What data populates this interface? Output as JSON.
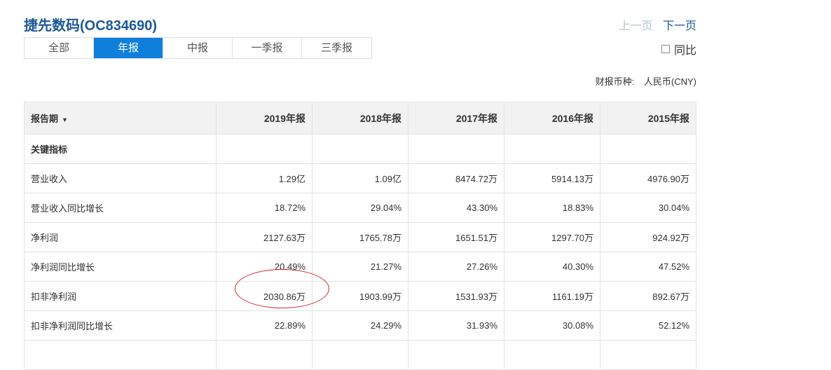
{
  "header": {
    "title": "捷先数码(OC834690)"
  },
  "tabs": [
    {
      "label": "全部"
    },
    {
      "label": "年报"
    },
    {
      "label": "中报"
    },
    {
      "label": "一季报"
    },
    {
      "label": "三季报"
    }
  ],
  "active_tab": "年报",
  "pager": {
    "prev": "上一页",
    "next": "下一页"
  },
  "yoy": {
    "label": "同比",
    "checked": false
  },
  "currency": {
    "label": "财报币种:",
    "value": "人民币(CNY)"
  },
  "table": {
    "header_label": "报告期",
    "sort_icon": "▼",
    "columns": [
      "2019年报",
      "2018年报",
      "2017年报",
      "2016年报",
      "2015年报"
    ],
    "section": "关键指标",
    "rows": [
      {
        "label": "营业收入",
        "values": [
          "1.29亿",
          "1.09亿",
          "8474.72万",
          "5914.13万",
          "4976.90万"
        ]
      },
      {
        "label": "营业收入同比增长",
        "values": [
          "18.72%",
          "29.04%",
          "43.30%",
          "18.83%",
          "30.04%"
        ]
      },
      {
        "label": "净利润",
        "values": [
          "2127.63万",
          "1765.78万",
          "1651.51万",
          "1297.70万",
          "924.92万"
        ]
      },
      {
        "label": "净利润同比增长",
        "values": [
          "20.49%",
          "21.27%",
          "27.26%",
          "40.30%",
          "47.52%"
        ]
      },
      {
        "label": "扣非净利润",
        "values": [
          "2030.86万",
          "1903.99万",
          "1531.93万",
          "1161.19万",
          "892.67万"
        ]
      },
      {
        "label": "扣非净利润同比增长",
        "values": [
          "22.89%",
          "24.29%",
          "31.93%",
          "30.08%",
          "52.12%"
        ]
      }
    ]
  },
  "highlight_color": "#d8232a"
}
